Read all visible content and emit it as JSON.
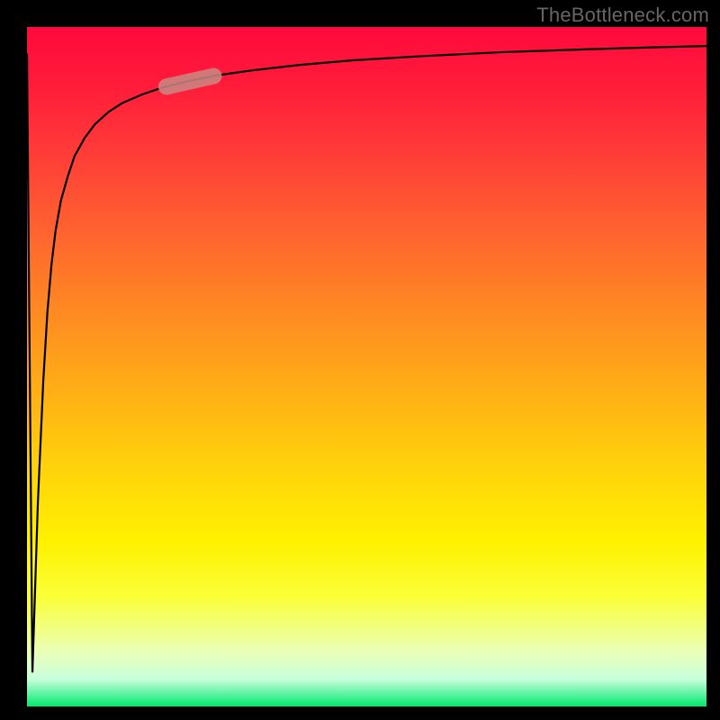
{
  "watermark": "TheBottleneck.com",
  "colors": {
    "frame": "#000000",
    "gradient_top": "#ff0a3c",
    "gradient_mid": "#ffd60a",
    "gradient_bottom": "#00e86e",
    "curve": "#000000",
    "marker": "#c98a85"
  },
  "chart_data": {
    "type": "line",
    "title": "",
    "xlabel": "",
    "ylabel": "",
    "xlim": [
      0,
      100
    ],
    "ylim": [
      0,
      100
    ],
    "grid": false,
    "x": [
      0.0,
      0.8,
      1.6,
      2.4,
      3.0,
      3.6,
      4.2,
      5.0,
      6.0,
      7.0,
      8.5,
      10.0,
      12.0,
      14.0,
      17.0,
      20.0,
      24.0,
      28.0,
      33.0,
      40.0,
      48.0,
      58.0,
      70.0,
      82.0,
      92.0,
      100.0
    ],
    "y": [
      96.0,
      5.0,
      30.0,
      48.0,
      58.0,
      65.0,
      70.0,
      74.5,
      78.0,
      81.0,
      83.7,
      85.7,
      87.5,
      88.8,
      90.1,
      91.1,
      92.1,
      92.9,
      93.6,
      94.4,
      95.1,
      95.7,
      96.3,
      96.7,
      97.0,
      97.2
    ],
    "marker": {
      "x_range": [
        20.0,
        28.0
      ],
      "y_range": [
        91.1,
        92.9
      ],
      "shape": "pill"
    },
    "annotations": []
  }
}
